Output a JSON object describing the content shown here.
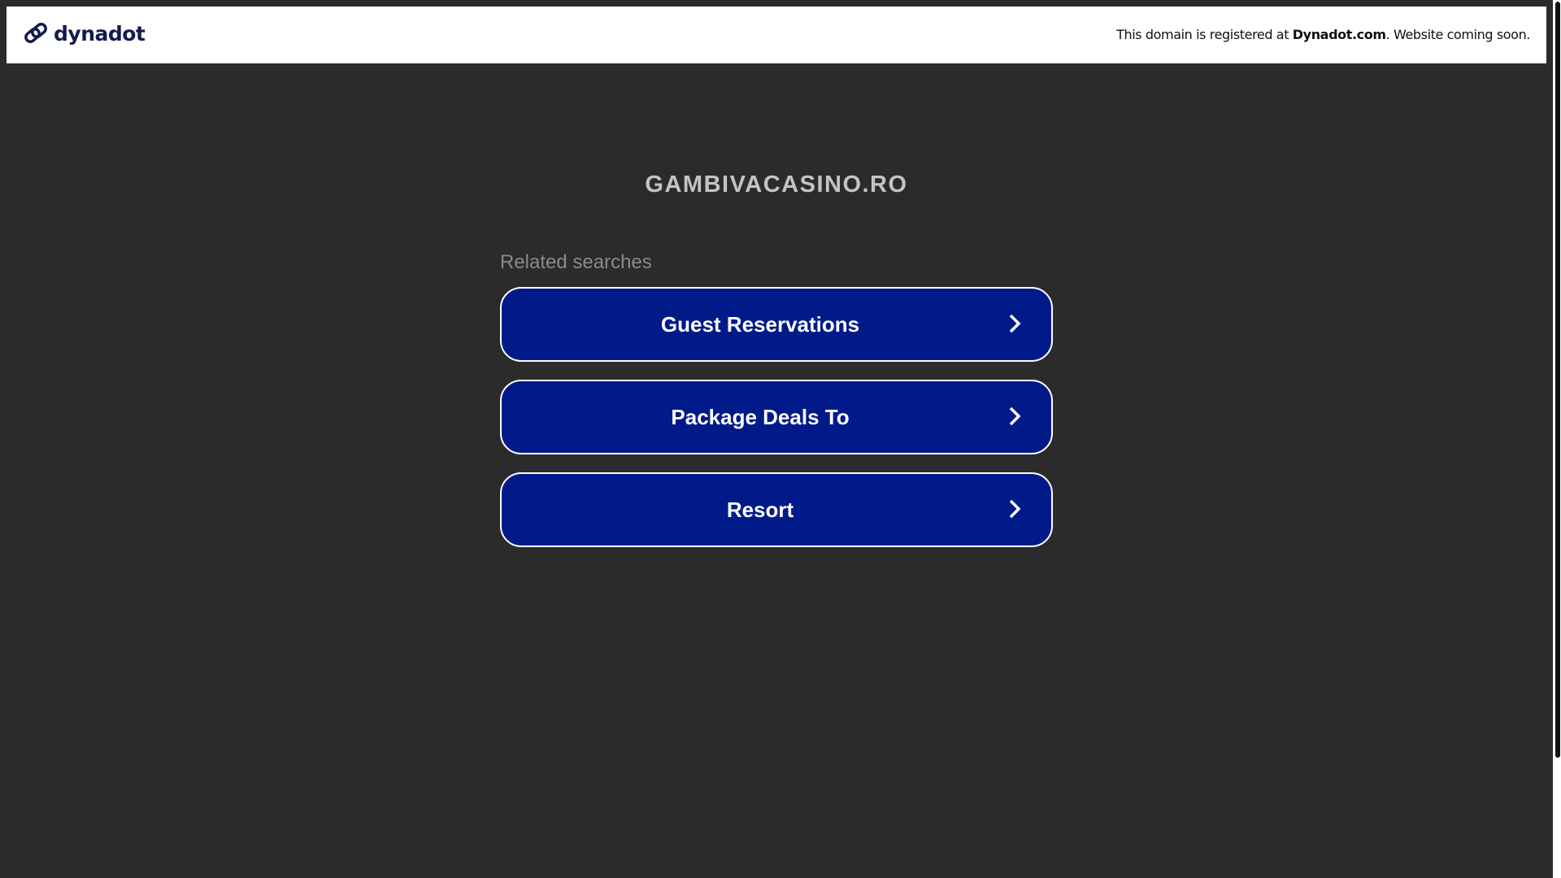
{
  "header": {
    "logo_text": "dynadot",
    "notice_prefix": "This domain is registered at ",
    "notice_brand": "Dynadot.com",
    "notice_suffix": ". Website coming soon."
  },
  "main": {
    "domain_title": "GAMBIVACASINO.RO",
    "related_label": "Related searches",
    "searches": [
      {
        "label": "Guest Reservations",
        "icon": "chevron-right-icon"
      },
      {
        "label": "Package Deals To",
        "icon": "chevron-right-icon"
      },
      {
        "label": "Resort",
        "icon": "chevron-right-icon"
      }
    ]
  },
  "colors": {
    "background": "#2b2b2b",
    "button": "#011a8a",
    "logo": "#141a4d"
  }
}
